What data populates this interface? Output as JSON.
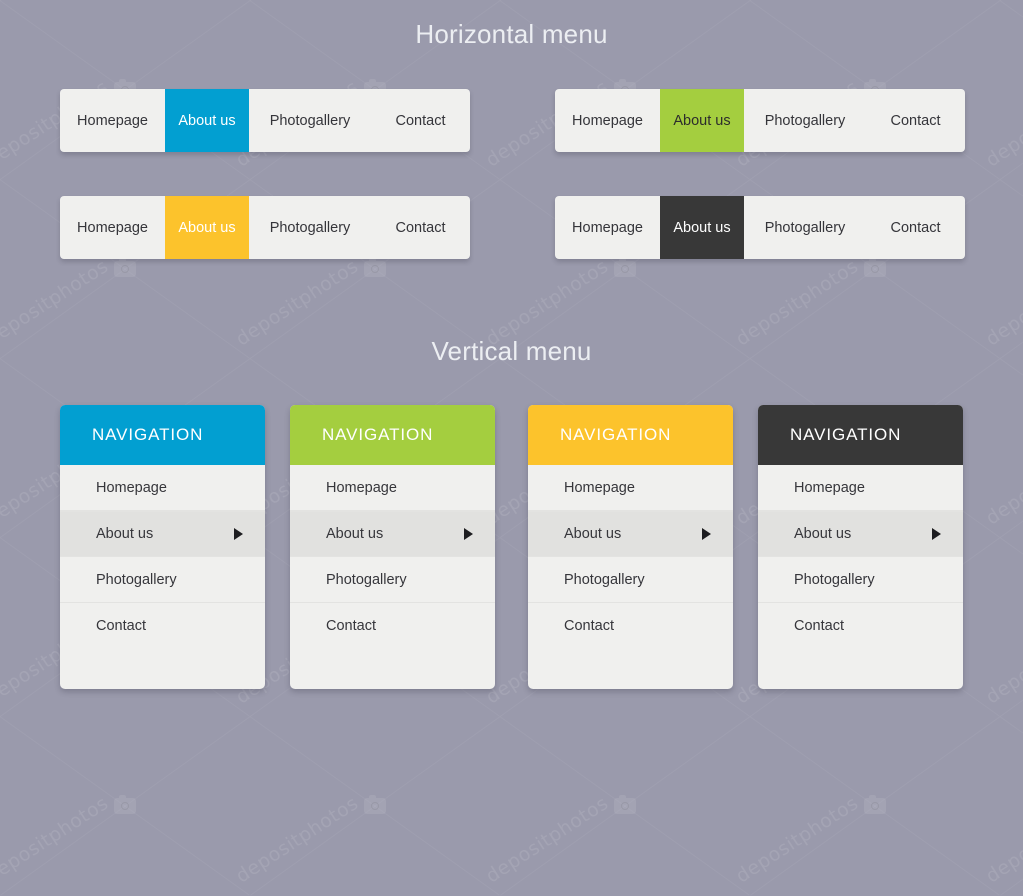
{
  "background_color": "#9a9aac",
  "sections": {
    "horizontal_title": "Horizontal menu",
    "vertical_title": "Vertical menu"
  },
  "watermark": {
    "brand": "depositphotos",
    "icon": "camera-icon"
  },
  "horizontal_menus": [
    {
      "id": "blue",
      "accent_color": "#029fd1",
      "active_label_color": "#ffffff",
      "bar_color": "#f0f0ee",
      "items": [
        {
          "label": "Homepage",
          "active": false
        },
        {
          "label": "About us",
          "active": true
        },
        {
          "label": "Photogallery",
          "active": false
        },
        {
          "label": "Contact",
          "active": false
        }
      ]
    },
    {
      "id": "green",
      "accent_color": "#a4ce3f",
      "active_label_color": "#2c2c2c",
      "bar_color": "#f0f0ee",
      "items": [
        {
          "label": "Homepage",
          "active": false
        },
        {
          "label": "About us",
          "active": true
        },
        {
          "label": "Photogallery",
          "active": false
        },
        {
          "label": "Contact",
          "active": false
        }
      ]
    },
    {
      "id": "yellow",
      "accent_color": "#fcc32c",
      "active_label_color": "#ffffff",
      "bar_color": "#f0f0ee",
      "items": [
        {
          "label": "Homepage",
          "active": false
        },
        {
          "label": "About us",
          "active": true
        },
        {
          "label": "Photogallery",
          "active": false
        },
        {
          "label": "Contact",
          "active": false
        }
      ]
    },
    {
      "id": "dark",
      "accent_color": "#383838",
      "active_label_color": "#ffffff",
      "bar_color": "#f0f0ee",
      "items": [
        {
          "label": "Homepage",
          "active": false
        },
        {
          "label": "About us",
          "active": true
        },
        {
          "label": "Photogallery",
          "active": false
        },
        {
          "label": "Contact",
          "active": false
        }
      ]
    }
  ],
  "vertical_menus": [
    {
      "id": "blue",
      "header": "NAVIGATION",
      "header_color": "#029fd1",
      "header_text_color": "#ffffff",
      "items": [
        {
          "label": "Homepage",
          "active": false,
          "submenu_arrow": false
        },
        {
          "label": "About us",
          "active": true,
          "submenu_arrow": true
        },
        {
          "label": "Photogallery",
          "active": false,
          "submenu_arrow": false
        },
        {
          "label": "Contact",
          "active": false,
          "submenu_arrow": false
        }
      ]
    },
    {
      "id": "green",
      "header": "NAVIGATION",
      "header_color": "#a4ce3f",
      "header_text_color": "#ffffff",
      "items": [
        {
          "label": "Homepage",
          "active": false,
          "submenu_arrow": false
        },
        {
          "label": "About us",
          "active": true,
          "submenu_arrow": true
        },
        {
          "label": "Photogallery",
          "active": false,
          "submenu_arrow": false
        },
        {
          "label": "Contact",
          "active": false,
          "submenu_arrow": false
        }
      ]
    },
    {
      "id": "yellow",
      "header": "NAVIGATION",
      "header_color": "#fcc32c",
      "header_text_color": "#ffffff",
      "items": [
        {
          "label": "Homepage",
          "active": false,
          "submenu_arrow": false
        },
        {
          "label": "About us",
          "active": true,
          "submenu_arrow": true
        },
        {
          "label": "Photogallery",
          "active": false,
          "submenu_arrow": false
        },
        {
          "label": "Contact",
          "active": false,
          "submenu_arrow": false
        }
      ]
    },
    {
      "id": "dark",
      "header": "NAVIGATION",
      "header_color": "#383838",
      "header_text_color": "#ffffff",
      "items": [
        {
          "label": "Homepage",
          "active": false,
          "submenu_arrow": false
        },
        {
          "label": "About us",
          "active": true,
          "submenu_arrow": true
        },
        {
          "label": "Photogallery",
          "active": false,
          "submenu_arrow": false
        },
        {
          "label": "Contact",
          "active": false,
          "submenu_arrow": false
        }
      ]
    }
  ]
}
